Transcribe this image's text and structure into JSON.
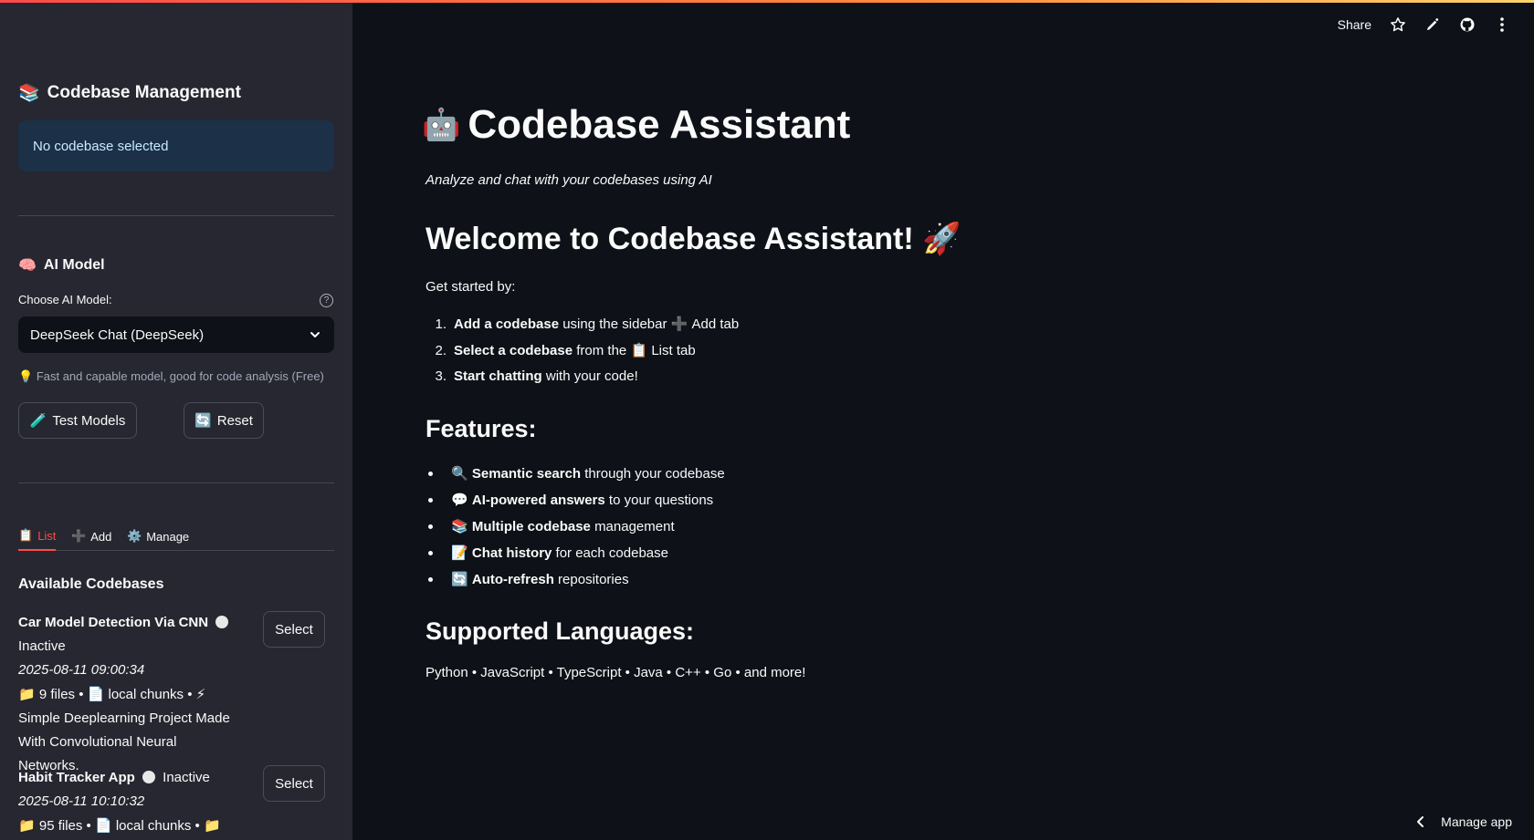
{
  "sidebar": {
    "title": "Codebase Management",
    "title_icon": "📚",
    "status": "No codebase selected",
    "ai_model": {
      "title": "AI Model",
      "title_icon": "🧠",
      "label": "Choose AI Model:",
      "selected": "DeepSeek Chat (DeepSeek)",
      "hint_icon": "💡",
      "hint": "Fast and capable model, good for code analysis (Free)",
      "test_button": "Test Models",
      "test_icon": "🧪",
      "reset_button": "Reset",
      "reset_icon": "🔄"
    },
    "tabs": [
      {
        "label": "List",
        "icon": "📋"
      },
      {
        "label": "Add",
        "icon": "➕"
      },
      {
        "label": "Manage",
        "icon": "⚙️"
      }
    ],
    "available_title": "Available Codebases",
    "codebases": [
      {
        "name": "Car Model Detection Via CNN",
        "status": "Inactive",
        "date": "2025-08-11 09:00:34",
        "files": "9 files",
        "chunks": "local chunks",
        "description_line1": "Simple Deeplearning Project Made",
        "description_line2": "With Convolutional Neural Networks.",
        "select_label": "Select"
      },
      {
        "name": "Habit Tracker App",
        "status": "Inactive",
        "date": "2025-08-11 10:10:32",
        "files": "95 files",
        "chunks": "local chunks",
        "select_label": "Select"
      }
    ]
  },
  "header": {
    "share_label": "Share"
  },
  "main": {
    "title": "Codebase Assistant",
    "title_icon": "🤖",
    "subtitle": "Analyze and chat with your codebases using AI",
    "welcome": "Welcome to Codebase Assistant!",
    "welcome_icon": "🚀",
    "get_started": "Get started by:",
    "steps": [
      {
        "num": "1.",
        "bold": "Add a codebase",
        "rest": "using the sidebar",
        "tail": "Add tab",
        "tail_icon": "➕"
      },
      {
        "num": "2.",
        "bold": "Select a codebase",
        "rest": "from the",
        "tail": "List tab",
        "tail_icon": "📋"
      },
      {
        "num": "3.",
        "bold": "Start chatting",
        "rest": "with your code!"
      }
    ],
    "features_title": "Features:",
    "features": [
      {
        "icon": "🔍",
        "bold": "Semantic search",
        "rest": "through your codebase"
      },
      {
        "icon": "💬",
        "bold": "AI-powered answers",
        "rest": "to your questions"
      },
      {
        "icon": "📚",
        "bold": "Multiple codebase",
        "rest": "management"
      },
      {
        "icon": "📝",
        "bold": "Chat history",
        "rest": "for each codebase"
      },
      {
        "icon": "🔄",
        "bold": "Auto-refresh",
        "rest": "repositories"
      }
    ],
    "languages_title": "Supported Languages:",
    "languages": "Python • JavaScript • TypeScript • Java • C++ • Go • and more!"
  },
  "footer": {
    "manage_app": "Manage app"
  }
}
